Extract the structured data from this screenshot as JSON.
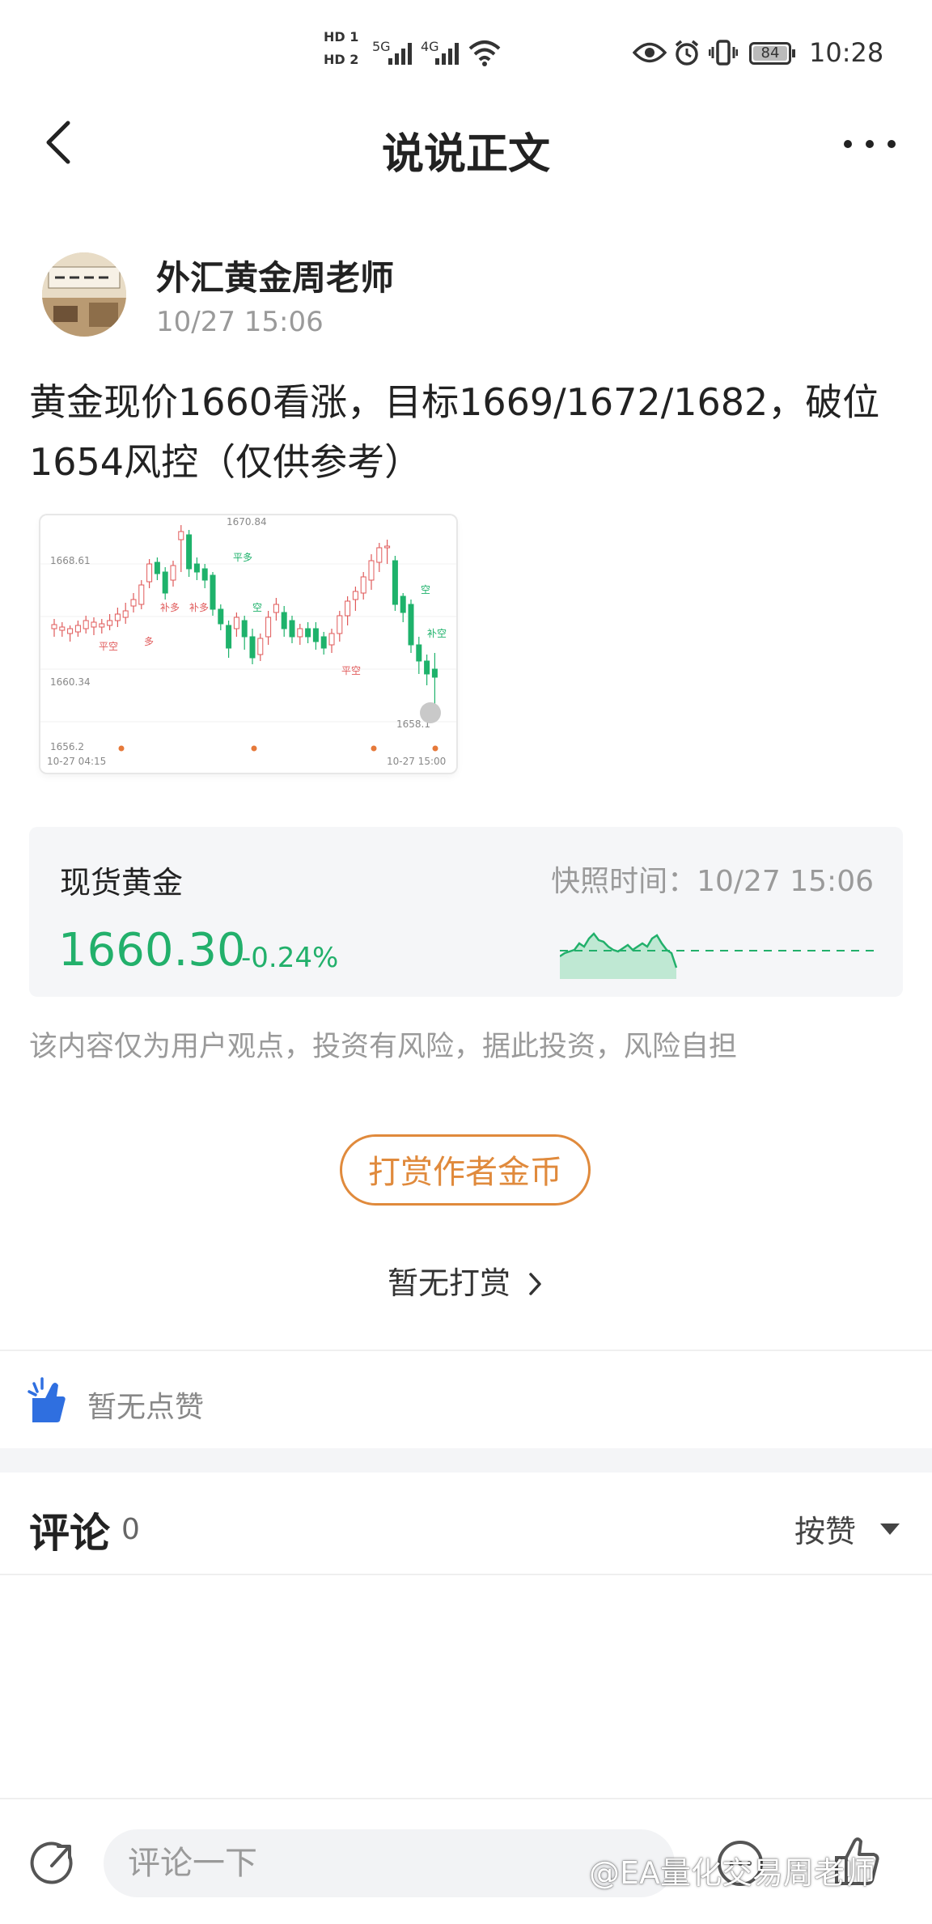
{
  "status_bar": {
    "time": "10:28",
    "battery": "84",
    "sim1": "HD 1",
    "sim2": "HD 2",
    "net1": "5G",
    "net2": "4G"
  },
  "header": {
    "title": "说说正文"
  },
  "post": {
    "author": "外汇黄金周老师",
    "time": "10/27 15:06",
    "text": "黄金现价1660看涨，目标1669/1672/1682，破位1654风控（仅供参考）",
    "chart_image": {
      "price_labels": [
        "1670.84",
        "1668.61",
        "1660.34",
        "1658.1",
        "1656.2"
      ],
      "time_labels": [
        "10-27 04:15",
        "10-27 15:00"
      ],
      "annotations": [
        "平空",
        "多",
        "补多",
        "补多",
        "平多",
        "空",
        "平空",
        "空",
        "补空"
      ],
      "colors": {
        "up": "#e05a5a",
        "down": "#1eb26b"
      }
    }
  },
  "quote": {
    "name": "现货黄金",
    "snapshot_label": "快照时间：10/27 15:06",
    "price": "1660.30",
    "change": "-0.24%",
    "color": "#22b06b"
  },
  "disclaimer": "该内容仅为用户观点，投资有风险，据此投资，风险自担",
  "reward": {
    "button": "打赏作者金币",
    "none": "暂无打赏"
  },
  "likes": {
    "none": "暂无点赞"
  },
  "comments": {
    "title": "评论",
    "count": "0",
    "sort": "按赞"
  },
  "bottom_bar": {
    "input_placeholder": "评论一下",
    "watermark": "@EA量化交易周老师"
  },
  "colors": {
    "accent_green": "#22b06b",
    "accent_orange": "#e08a3c",
    "like_blue": "#2f6fe0"
  }
}
